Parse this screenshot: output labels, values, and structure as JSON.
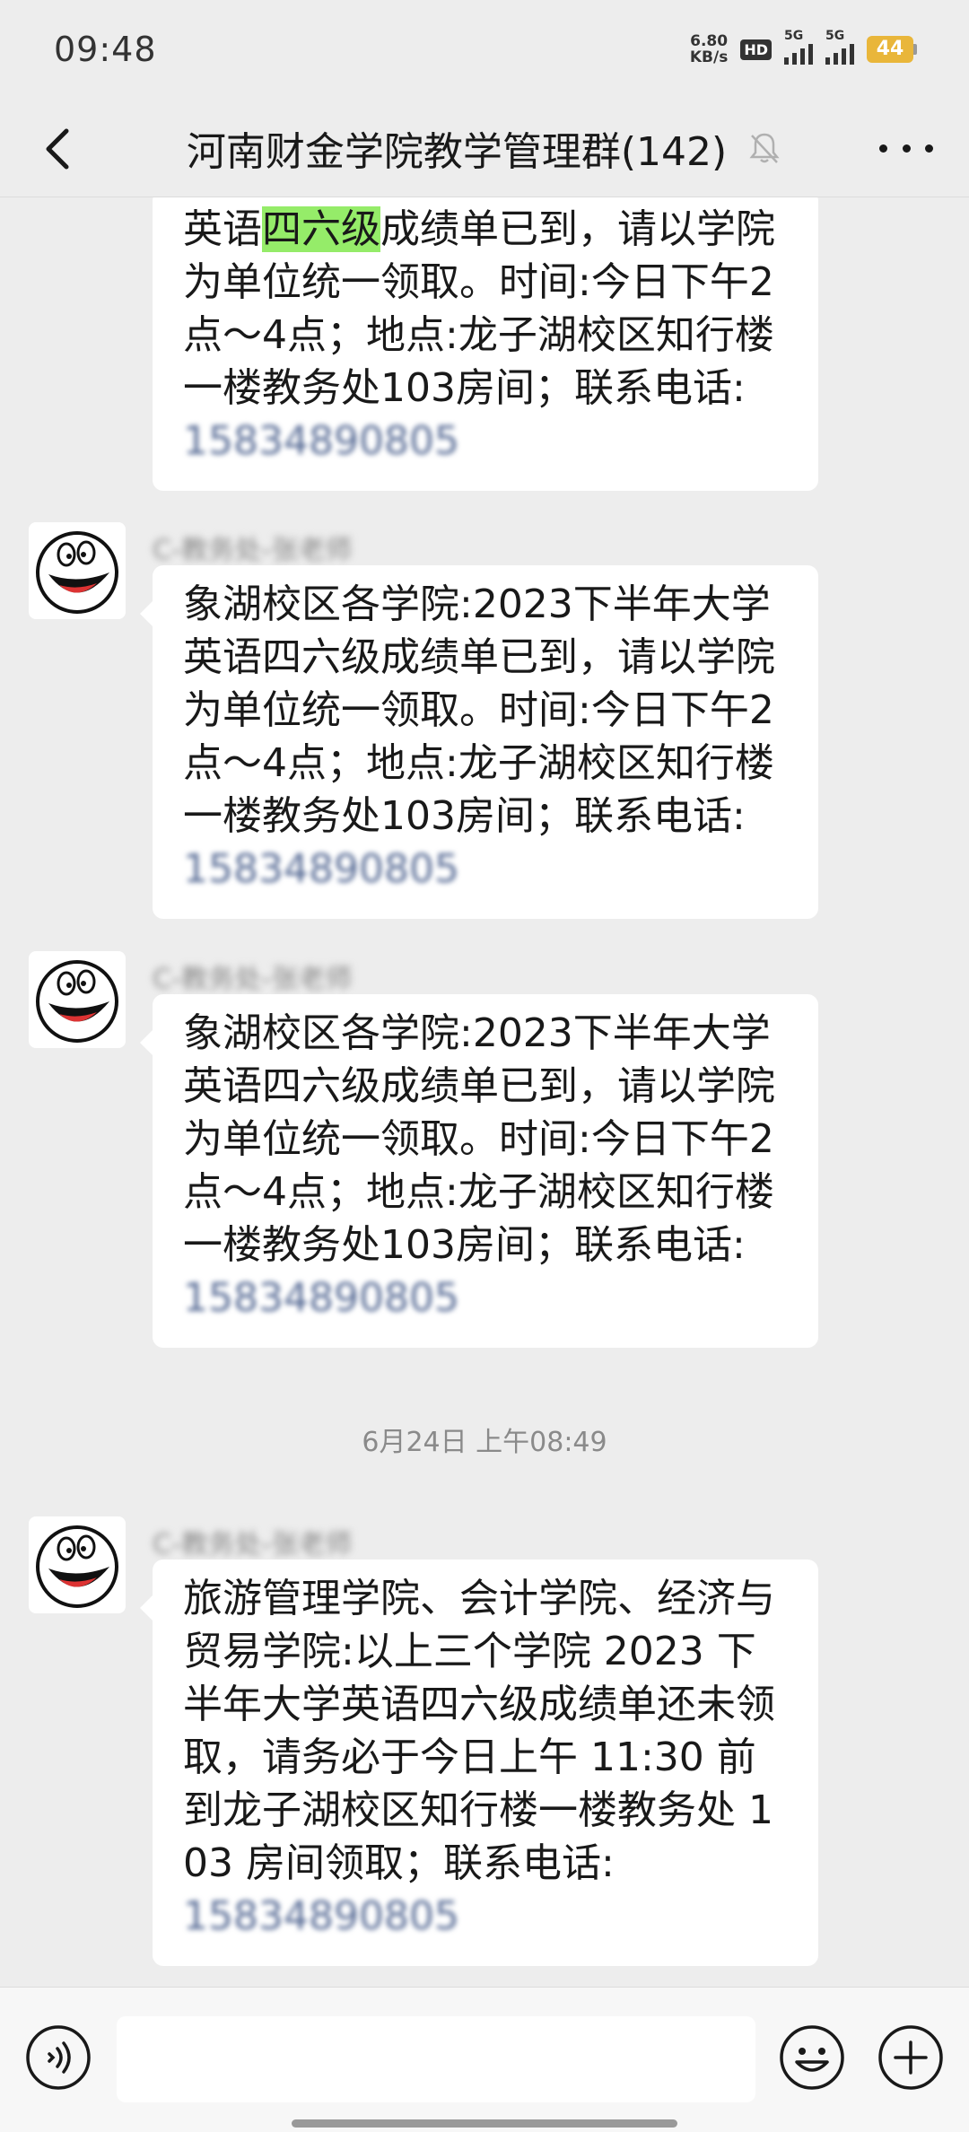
{
  "status_bar": {
    "time": "09:48",
    "net_speed_value": "6.80",
    "net_speed_unit": "KB/s",
    "hd_label": "HD",
    "sim1_label": "5G",
    "sim2_label": "5G",
    "battery": "44",
    "battery_color": "#e9b63a"
  },
  "header": {
    "title": "河南财金学院教学管理群(142)",
    "back_icon": "chevron-left-icon",
    "mute_icon": "bell-muted-icon",
    "more_icon": "more-dots-icon"
  },
  "messages": [
    {
      "pre": "英语",
      "highlight": "四六级",
      "text": "成绩单已到，请以学院为单位统一领取。时间:今日下午2点～4点；地点:龙子湖校区知行楼一楼教务处103房间；联系电话:",
      "phone": "15834890805"
    },
    {
      "sender": "C-教务处-张老师",
      "text": "象湖校区各学院:2023下半年大学英语四六级成绩单已到，请以学院为单位统一领取。时间:今日下午2点～4点；地点:龙子湖校区知行楼一楼教务处103房间；联系电话:",
      "phone": "15834890805"
    },
    {
      "sender": "C-教务处-张老师",
      "text": "象湖校区各学院:2023下半年大学英语四六级成绩单已到，请以学院为单位统一领取。时间:今日下午2点～4点；地点:龙子湖校区知行楼一楼教务处103房间；联系电话:",
      "phone": "15834890805"
    },
    {
      "sender": "C-教务处-张老师",
      "text": "旅游管理学院、会计学院、经济与贸易学院:以上三个学院 2023 下半年大学英语四六级成绩单还未领取，请务必于今日上午 11:30 前到龙子湖校区知行楼一楼教务处 103 房间领取；联系电话:",
      "phone": "15834890805"
    }
  ],
  "time_divider": "6月24日 上午08:49",
  "input_bar": {
    "voice_icon": "voice-icon",
    "emoji_icon": "emoji-icon",
    "plus_icon": "plus-icon"
  },
  "colors": {
    "background": "#ededed",
    "bubble": "#ffffff",
    "highlight": "#95ec69",
    "link": "#576b95"
  }
}
